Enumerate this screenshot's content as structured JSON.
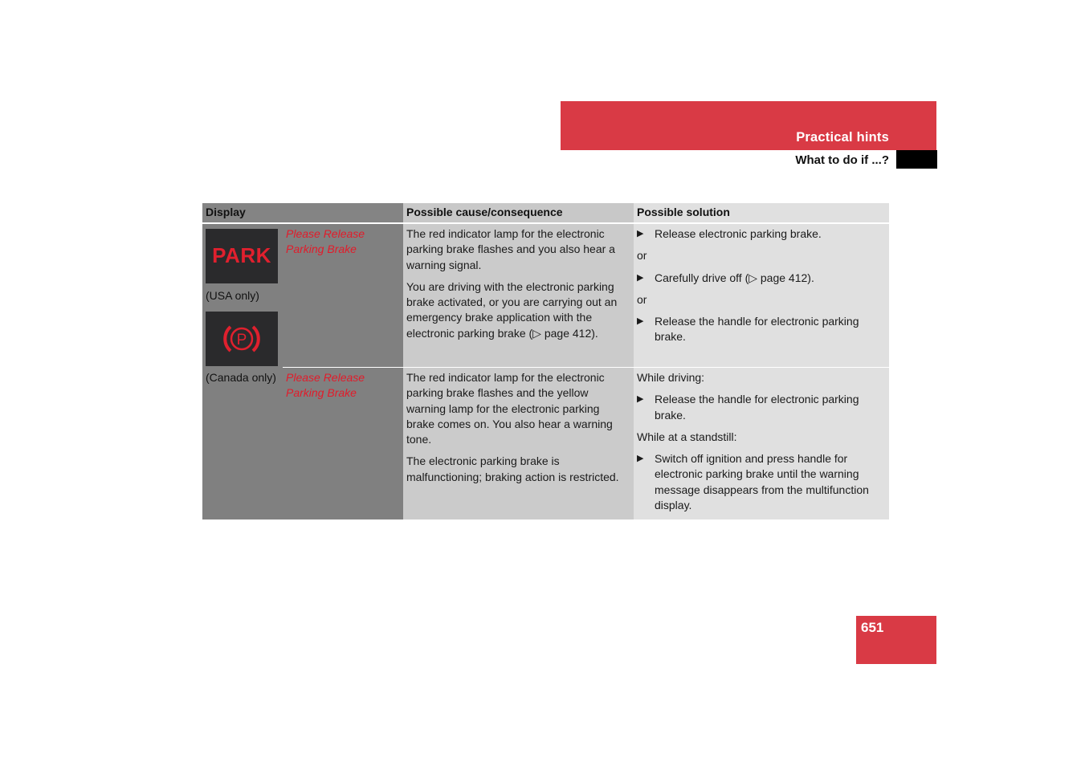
{
  "header": {
    "section_title": "Practical hints",
    "subsection_title": "What to do if ...?",
    "accent_color": "#d93a45"
  },
  "table": {
    "columns": [
      "Display",
      "Possible cause/consequence",
      "Possible solution"
    ],
    "rows": [
      {
        "display": {
          "icons": [
            {
              "name": "park-warning-icon",
              "label": "PARK",
              "region": "(USA only)"
            },
            {
              "name": "parking-brake-p-icon",
              "label": "P",
              "region": "(Canada only)"
            }
          ],
          "message": [
            "Please Release",
            "Parking Brake"
          ]
        },
        "cause": [
          "The red indicator lamp for the electronic parking brake flashes and you also hear a warning signal.",
          "You are driving with the electronic parking brake activated, or you are carrying out an emergency brake application with the electronic parking brake (▷ page 412)."
        ],
        "solution": [
          {
            "type": "bullet",
            "text": "Release electronic parking brake."
          },
          {
            "type": "text",
            "text": "or"
          },
          {
            "type": "bullet",
            "text": "Carefully drive off (▷ page 412)."
          },
          {
            "type": "text",
            "text": "or"
          },
          {
            "type": "bullet",
            "text": "Release the handle for electronic parking brake."
          }
        ]
      },
      {
        "display": {
          "region": "(Canada only)",
          "message": [
            "Please Release",
            "Parking Brake"
          ]
        },
        "cause": [
          "The red indicator lamp for the electronic parking brake flashes and the yellow warning lamp for the electronic parking brake comes on. You also hear a warning tone.",
          "The electronic parking brake is malfunctioning; braking action is restricted."
        ],
        "solution": [
          {
            "type": "text",
            "text": "While driving:"
          },
          {
            "type": "bullet",
            "text": "Release the handle for electronic parking brake."
          },
          {
            "type": "text",
            "text": "While at a standstill:"
          },
          {
            "type": "bullet",
            "text": "Switch off ignition and press handle for electronic parking brake until the warning message disappears from the multifunction display."
          }
        ]
      }
    ]
  },
  "page_number": "651",
  "bullet_glyph": "▶"
}
